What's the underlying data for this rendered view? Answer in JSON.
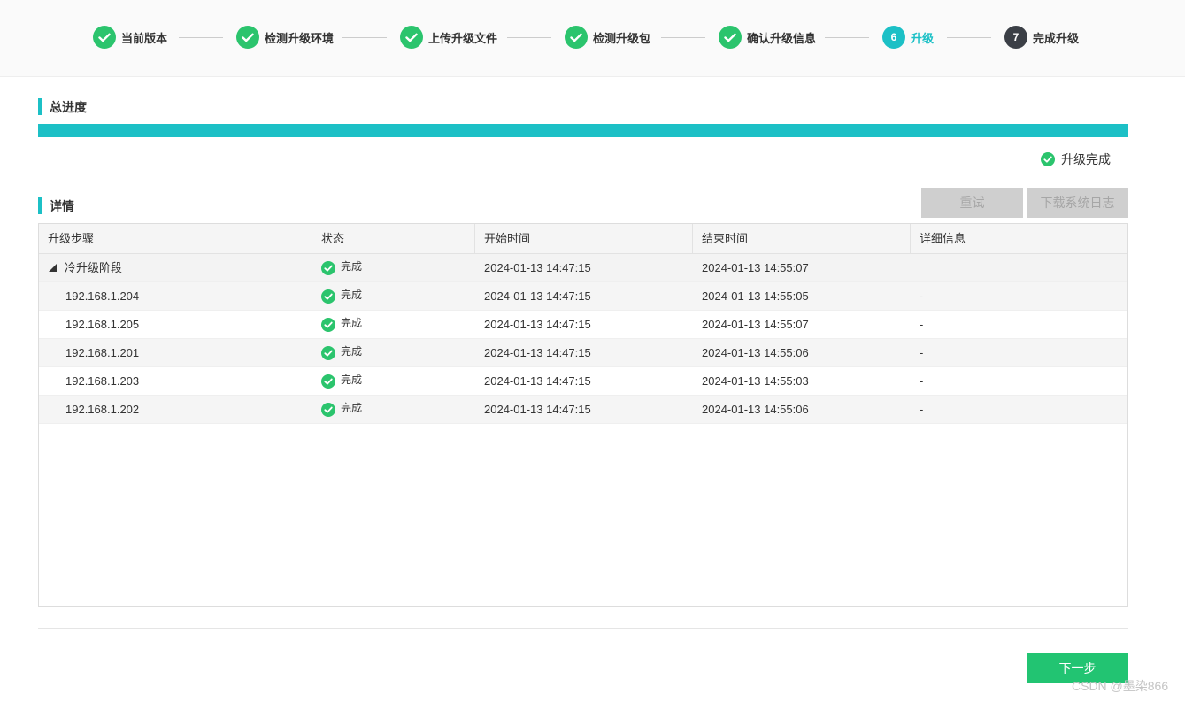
{
  "stepper": {
    "steps": [
      {
        "label": "当前版本",
        "state": "done",
        "number": ""
      },
      {
        "label": "检测升级环境",
        "state": "done",
        "number": ""
      },
      {
        "label": "上传升级文件",
        "state": "done",
        "number": ""
      },
      {
        "label": "检测升级包",
        "state": "done",
        "number": ""
      },
      {
        "label": "确认升级信息",
        "state": "done",
        "number": ""
      },
      {
        "label": "升级",
        "state": "current",
        "number": "6"
      },
      {
        "label": "完成升级",
        "state": "pending",
        "number": "7"
      }
    ]
  },
  "overall": {
    "title": "总进度",
    "progress_percent": 100,
    "status_text": "升级完成"
  },
  "details": {
    "title": "详情",
    "retry_label": "重试",
    "download_log_label": "下载系统日志",
    "columns": [
      "升级步骤",
      "状态",
      "开始时间",
      "结束时间",
      "详细信息"
    ],
    "group": {
      "name": "冷升级阶段",
      "status": "完成",
      "start": "2024-01-13 14:47:15",
      "end": "2024-01-13 14:55:07",
      "detail": ""
    },
    "rows": [
      {
        "name": "192.168.1.204",
        "status": "完成",
        "start": "2024-01-13 14:47:15",
        "end": "2024-01-13 14:55:05",
        "detail": "-"
      },
      {
        "name": "192.168.1.205",
        "status": "完成",
        "start": "2024-01-13 14:47:15",
        "end": "2024-01-13 14:55:07",
        "detail": "-"
      },
      {
        "name": "192.168.1.201",
        "status": "完成",
        "start": "2024-01-13 14:47:15",
        "end": "2024-01-13 14:55:06",
        "detail": "-"
      },
      {
        "name": "192.168.1.203",
        "status": "完成",
        "start": "2024-01-13 14:47:15",
        "end": "2024-01-13 14:55:03",
        "detail": "-"
      },
      {
        "name": "192.168.1.202",
        "status": "完成",
        "start": "2024-01-13 14:47:15",
        "end": "2024-01-13 14:55:06",
        "detail": "-"
      }
    ]
  },
  "footer": {
    "next_label": "下一步"
  },
  "watermark": "CSDN @墨染866",
  "colors": {
    "accent": "#1cc0c6",
    "success": "#2bc46d",
    "next_button": "#22c472",
    "pending_step": "#3b3f46",
    "disabled_button": "#cfcfcf"
  },
  "icons": {
    "done_step": "check-circle-icon",
    "status_done": "check-circle-icon",
    "group_toggle": "caret-expanded-icon"
  }
}
